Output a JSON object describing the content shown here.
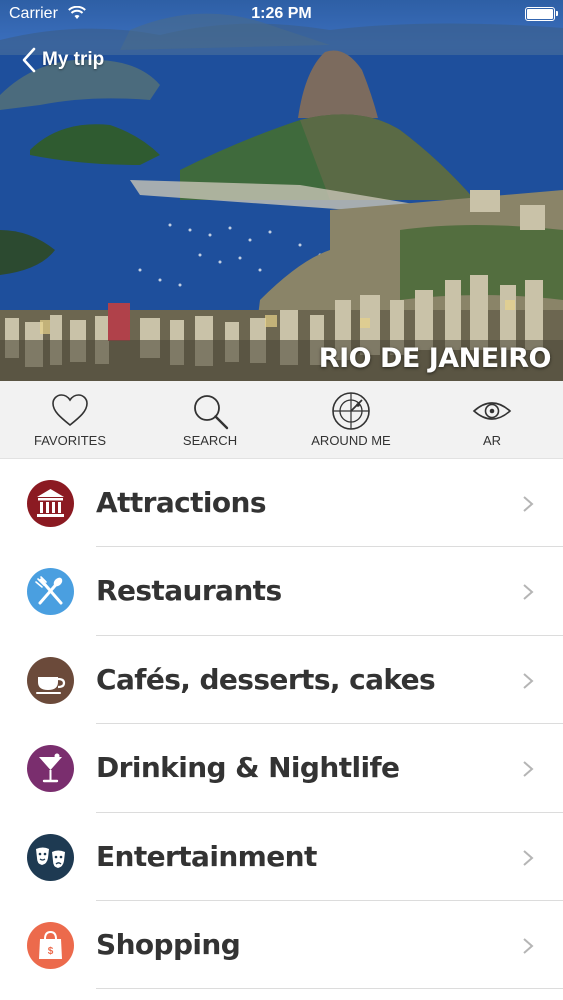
{
  "status_bar": {
    "carrier": "Carrier",
    "time": "1:26 PM"
  },
  "nav": {
    "back_label": "My trip"
  },
  "hero": {
    "city_title": "RIO DE JANEIRO"
  },
  "toolbar": {
    "items": [
      {
        "label": "FAVORITES",
        "icon": "heart-icon"
      },
      {
        "label": "SEARCH",
        "icon": "search-icon"
      },
      {
        "label": "AROUND ME",
        "icon": "radar-icon"
      },
      {
        "label": "AR",
        "icon": "eye-icon"
      }
    ]
  },
  "categories": [
    {
      "label": "Attractions",
      "icon": "museum-icon",
      "color": "#8b1a22"
    },
    {
      "label": "Restaurants",
      "icon": "fork-knife-icon",
      "color": "#4a9fe0"
    },
    {
      "label": "Cafés, desserts, cakes",
      "icon": "coffee-cup-icon",
      "color": "#6b4a3a"
    },
    {
      "label": "Drinking & Nightlife",
      "icon": "cocktail-icon",
      "color": "#7a2e6e"
    },
    {
      "label": "Entertainment",
      "icon": "theater-masks-icon",
      "color": "#1e3a52"
    },
    {
      "label": "Shopping",
      "icon": "shopping-bag-icon",
      "color": "#ec6a4c"
    }
  ]
}
